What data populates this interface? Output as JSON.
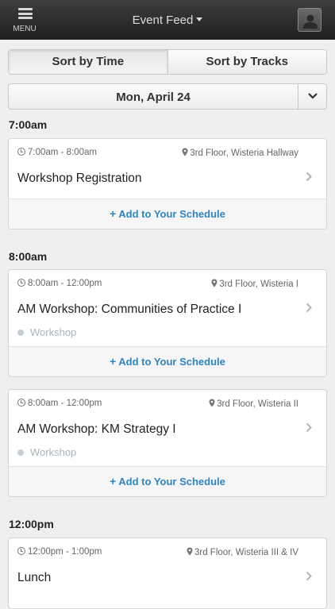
{
  "header": {
    "menu_label": "MENU",
    "title": "Event Feed",
    "menu_icon": "hamburger-icon",
    "profile_icon": "user-avatar-icon"
  },
  "sort_tabs": [
    {
      "label": "Sort by Time",
      "active": true
    },
    {
      "label": "Sort by Tracks",
      "active": false
    }
  ],
  "date_selector": {
    "value": "Mon, April 24"
  },
  "groups": [
    {
      "time": "7:00am",
      "sessions": [
        {
          "time_range": "7:00am - 8:00am",
          "location": "3rd Floor, Wisteria Hallway",
          "title": "Workshop Registration",
          "track": "",
          "action": "Add to Your Schedule"
        }
      ]
    },
    {
      "time": "8:00am",
      "sessions": [
        {
          "time_range": "8:00am - 12:00pm",
          "location": "3rd Floor, Wisteria I",
          "title": "AM Workshop: Communities of Practice I",
          "track": "Workshop",
          "action": "Add to Your Schedule"
        },
        {
          "time_range": "8:00am - 12:00pm",
          "location": "3rd Floor, Wisteria II",
          "title": "AM Workshop: KM Strategy I",
          "track": "Workshop",
          "action": "Add to Your Schedule"
        }
      ]
    },
    {
      "time": "12:00pm",
      "sessions": [
        {
          "time_range": "12:00pm - 1:00pm",
          "location": "3rd Floor, Wisteria III & IV",
          "title": "Lunch",
          "track": "",
          "action": ""
        }
      ]
    }
  ],
  "colors": {
    "accent": "#2e86c1",
    "topbar": "#2a2a2a",
    "track_dot": "#c5d0d6"
  }
}
